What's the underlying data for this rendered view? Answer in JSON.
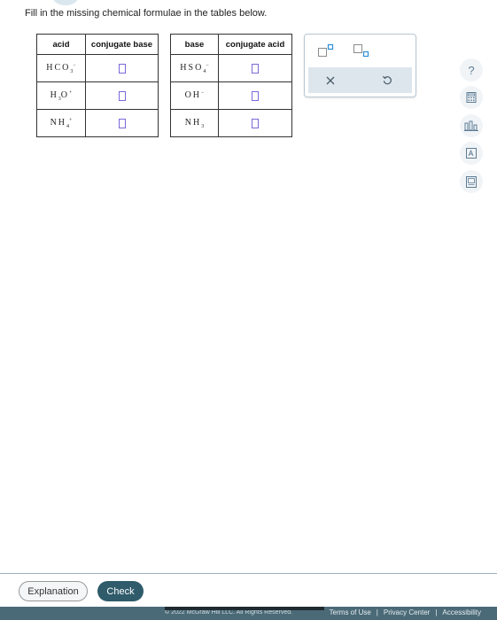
{
  "instructions": "Fill in the missing chemical formulae in the tables below.",
  "table_acids": {
    "headers": [
      "acid",
      "conjugate base"
    ],
    "rows": [
      {
        "acid": "HCO",
        "acid_sub": "3",
        "acid_sup": "−"
      },
      {
        "acid": "H",
        "acid_sub": "3",
        "acid_tail": "O",
        "acid_sup": "+"
      },
      {
        "acid": "NH",
        "acid_sub": "4",
        "acid_sup": "+"
      }
    ]
  },
  "table_bases": {
    "headers": [
      "base",
      "conjugate acid"
    ],
    "rows": [
      {
        "base": "HSO",
        "base_sub": "4",
        "base_sup": "−"
      },
      {
        "base": "OH",
        "base_sub": "",
        "base_sup": "−"
      },
      {
        "base": "NH",
        "base_sub": "3",
        "base_sup": ""
      }
    ]
  },
  "palette": {
    "icons": [
      "superscript-icon",
      "subscript-icon",
      "clear-icon",
      "undo-icon"
    ],
    "accent": "#2a8fd6"
  },
  "side_tools": {
    "help_label": "?",
    "icons": [
      "help-icon",
      "calculator-icon",
      "data-chart-icon",
      "reference-icon",
      "periodic-table-icon"
    ]
  },
  "buttons": {
    "explanation_label": "Explanation",
    "check_label": "Check"
  },
  "footer": {
    "copyright": "© 2022 McGraw Hill LLC. All Rights Reserved.",
    "terms": "Terms of Use",
    "privacy": "Privacy Center",
    "accessibility": "Accessibility"
  },
  "colors": {
    "answer_box": "#7a6ad8",
    "check_button": "#2f5b6b",
    "footer_bg": "#4b6a77"
  }
}
